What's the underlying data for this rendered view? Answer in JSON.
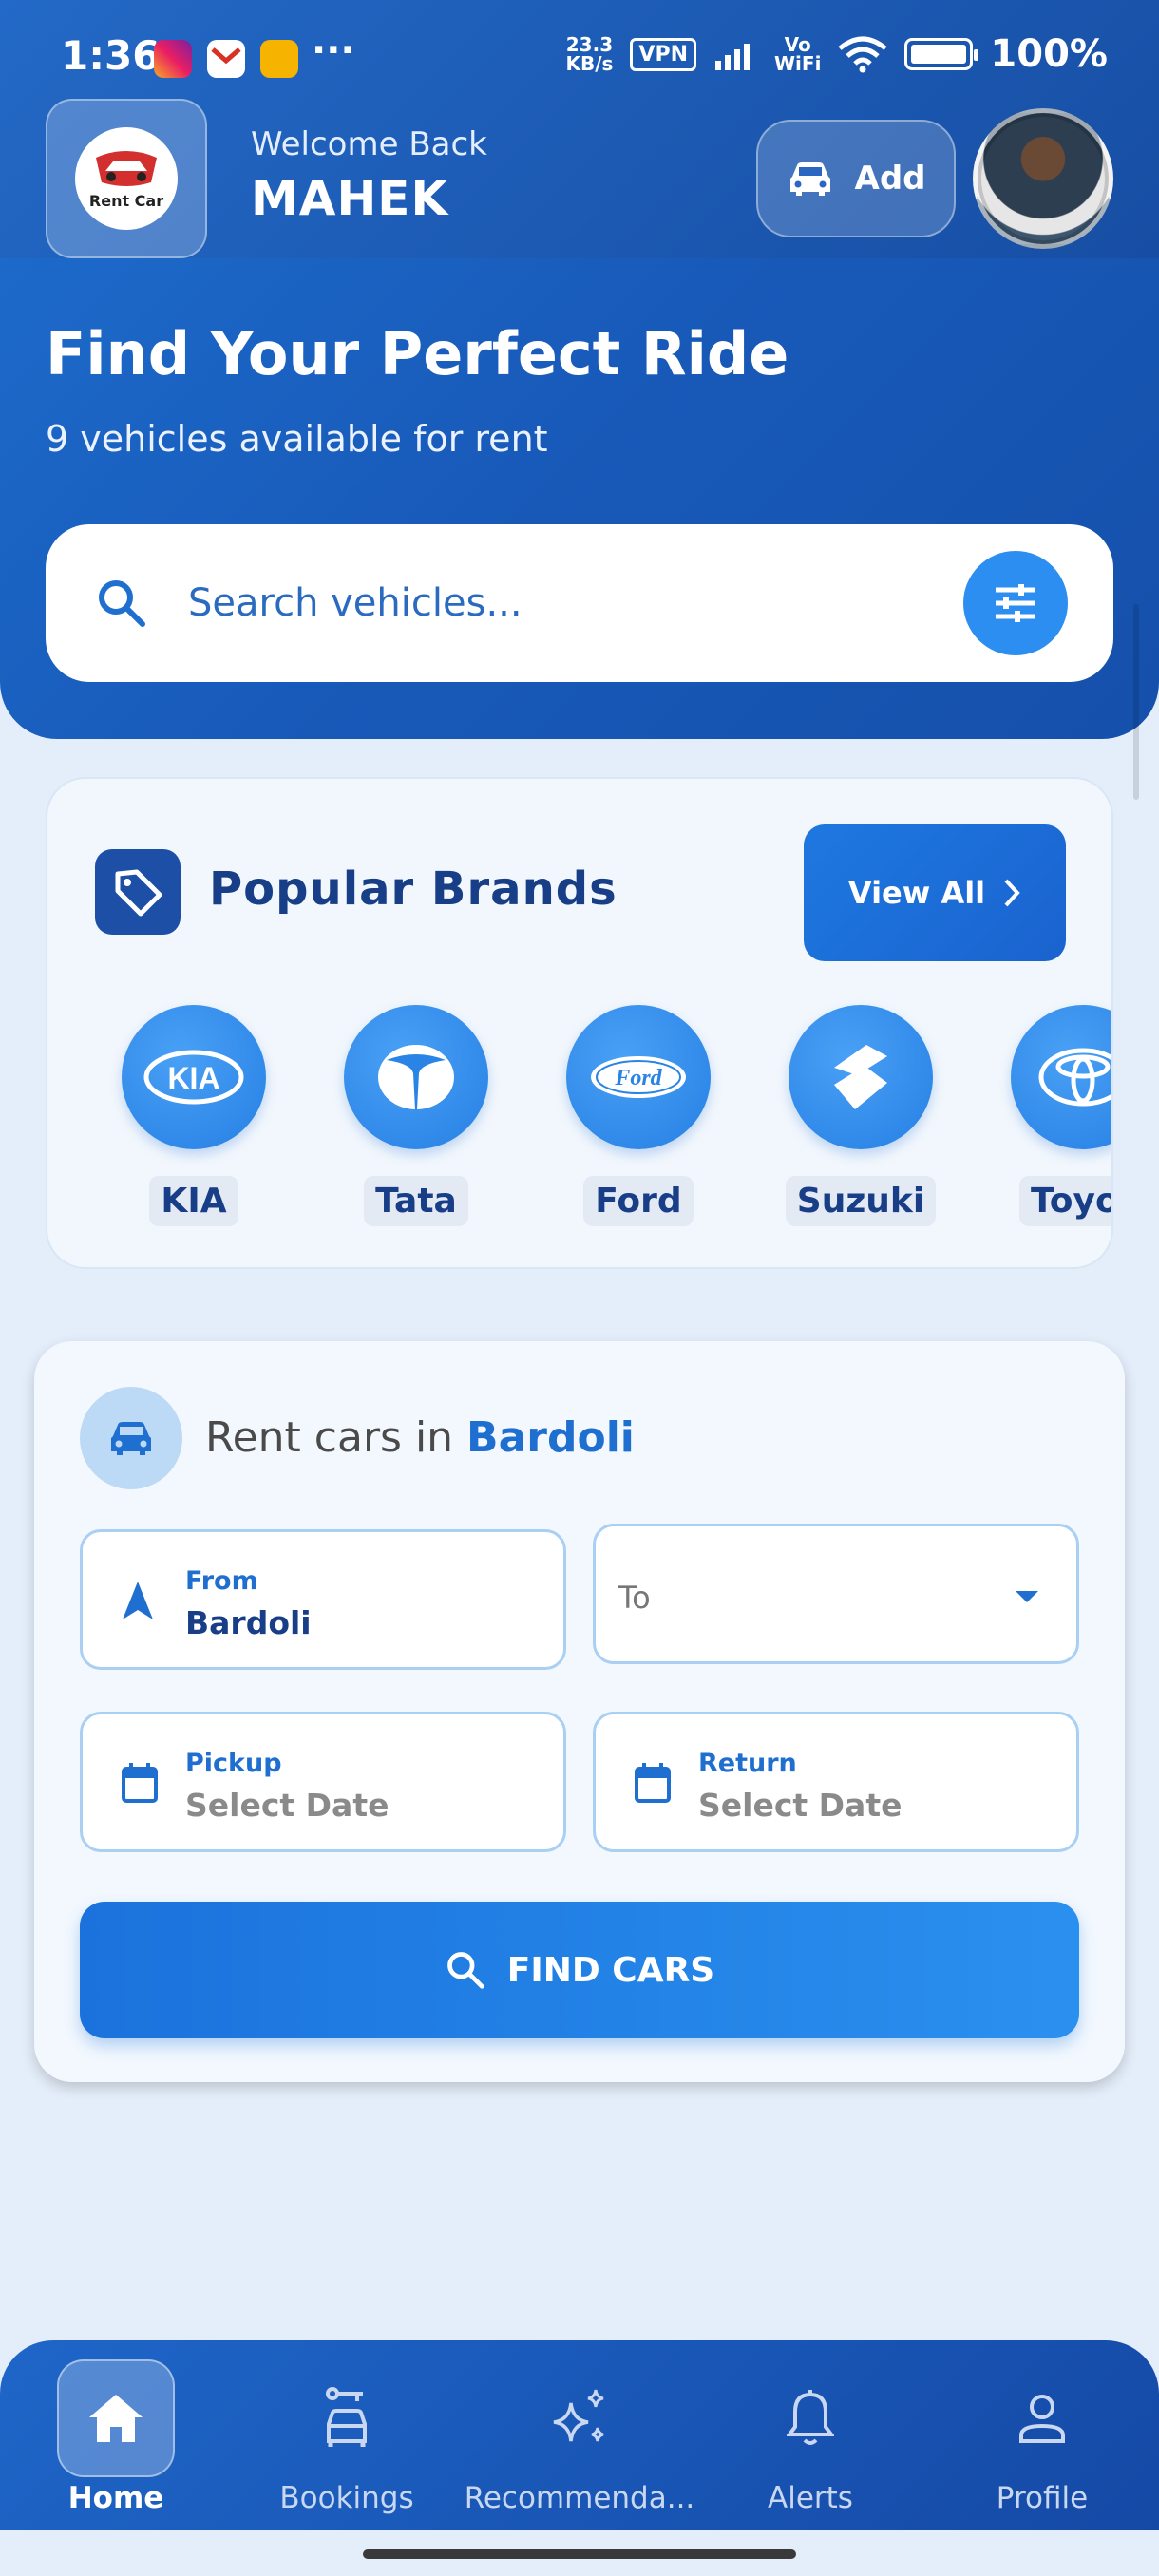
{
  "status_bar": {
    "time": "1:36",
    "network_speed_value": "23.3",
    "network_speed_unit": "KB/s",
    "vpn_label": "VPN",
    "volte_top": "Vo",
    "volte_bottom": "WiFi",
    "battery": "100%"
  },
  "header": {
    "logo_text": "Rent Car",
    "welcome": "Welcome Back",
    "username": "MAHEK",
    "add_label": "Add"
  },
  "hero": {
    "title": "Find Your Perfect Ride",
    "subtitle": "9 vehicles available for rent"
  },
  "search": {
    "placeholder": "Search vehicles..."
  },
  "brands": {
    "title": "Popular Brands",
    "view_all_label": "View All",
    "items": [
      {
        "label": "KIA"
      },
      {
        "label": "Tata"
      },
      {
        "label": "Ford"
      },
      {
        "label": "Suzuki"
      },
      {
        "label": "Toyot"
      }
    ]
  },
  "rent": {
    "title_prefix": "Rent cars in ",
    "city": "Bardoli",
    "from_label": "From",
    "from_value": "Bardoli",
    "to_placeholder": "To",
    "pickup_label": "Pickup",
    "pickup_value": "Select Date",
    "return_label": "Return",
    "return_value": "Select Date",
    "find_label": "FIND CARS"
  },
  "nav": {
    "items": [
      {
        "label": "Home"
      },
      {
        "label": "Bookings"
      },
      {
        "label": "Recommenda..."
      },
      {
        "label": "Alerts"
      },
      {
        "label": "Profile"
      }
    ]
  },
  "colors": {
    "primary": "#1e6fd0",
    "dark_blue": "#173e86",
    "accent": "#2c8ef0",
    "background": "#e4eefa"
  }
}
